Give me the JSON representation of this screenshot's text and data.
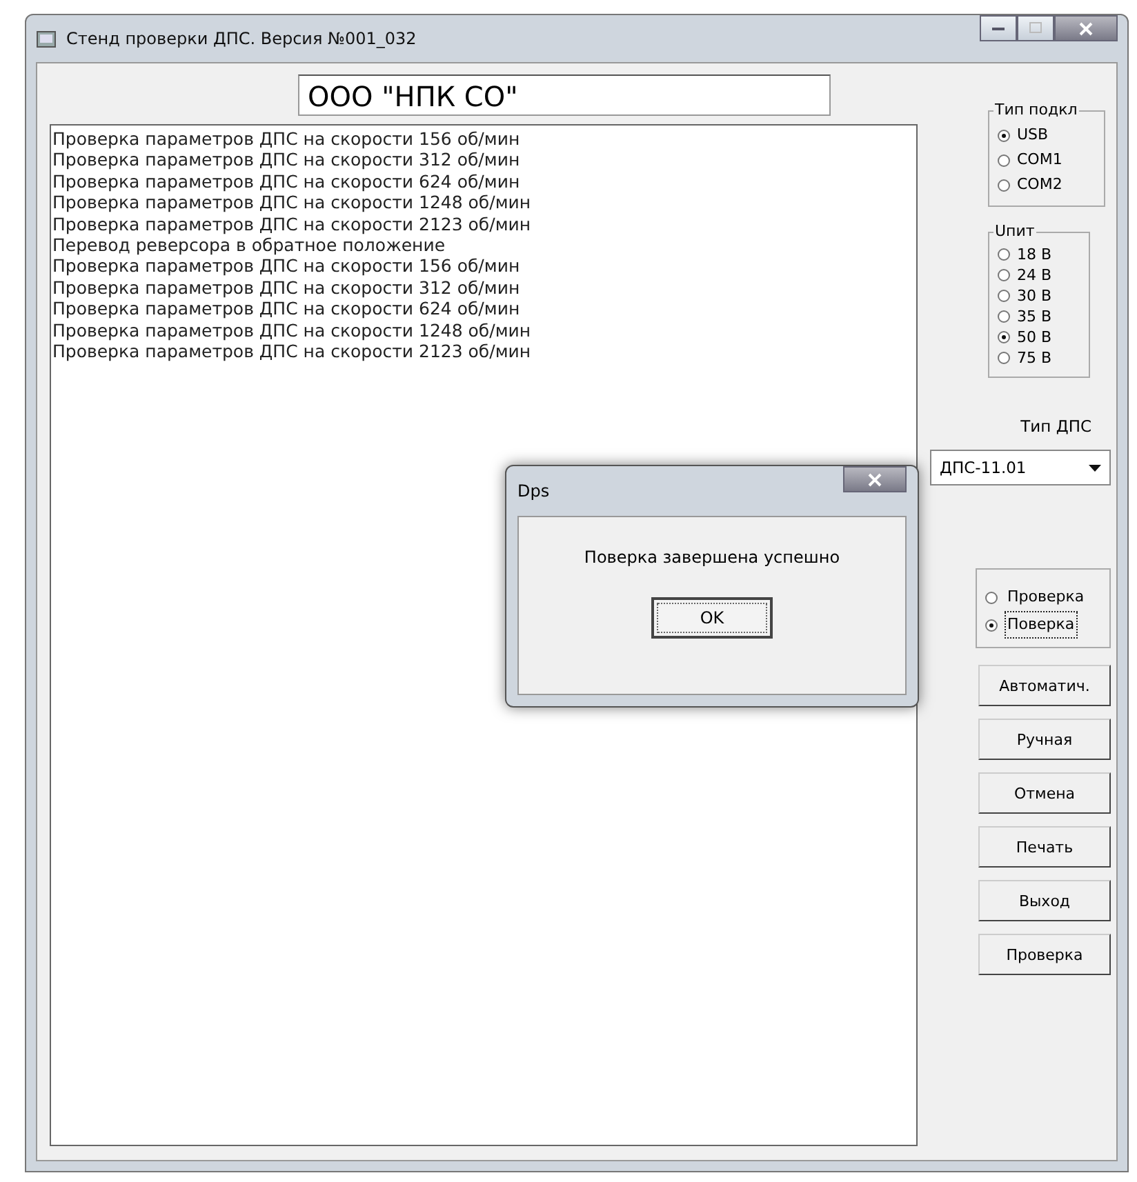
{
  "window": {
    "title": "Стенд проверки ДПС. Версия №001_032"
  },
  "company_field": {
    "value": "ООО \"НПК СО\""
  },
  "log": {
    "lines": [
      "Проверка параметров ДПС на скорости 156 об/мин",
      "Проверка параметров ДПС на скорости 312 об/мин",
      "Проверка параметров ДПС на скорости 624 об/мин",
      "Проверка параметров ДПС на скорости 1248 об/мин",
      "Проверка параметров ДПС на скорости 2123 об/мин",
      "Перевод реверсора в обратное положение",
      "Проверка параметров ДПС на скорости 156 об/мин",
      "Проверка параметров ДПС на скорости 312 об/мин",
      "Проверка параметров ДПС на скорости 624 об/мин",
      "Проверка параметров ДПС на скорости 1248 об/мин",
      "Проверка параметров ДПС на скорости 2123 об/мин"
    ]
  },
  "connection_group": {
    "title": "Тип подкл",
    "options": [
      {
        "label": "USB",
        "selected": true
      },
      {
        "label": "COM1",
        "selected": false
      },
      {
        "label": "COM2",
        "selected": false
      }
    ]
  },
  "voltage_group": {
    "title": "Uпит",
    "options": [
      {
        "label": "18 В",
        "selected": false
      },
      {
        "label": "24 В",
        "selected": false
      },
      {
        "label": "30 В",
        "selected": false
      },
      {
        "label": "35 В",
        "selected": false
      },
      {
        "label": "50 В",
        "selected": true
      },
      {
        "label": "75 В",
        "selected": false
      }
    ]
  },
  "sensor_type": {
    "label": "Тип ДПС",
    "value": "ДПС-11.01"
  },
  "mode_group": {
    "options": [
      {
        "label": "Проверка",
        "selected": false,
        "focused": false
      },
      {
        "label": "Поверка",
        "selected": true,
        "focused": true
      }
    ]
  },
  "buttons": [
    "Автоматич.",
    "Ручная",
    "Отмена",
    "Печать",
    "Выход",
    "Проверка"
  ],
  "dialog": {
    "title": "Dps",
    "message": "Поверка завершена успешно",
    "button": "OK"
  }
}
